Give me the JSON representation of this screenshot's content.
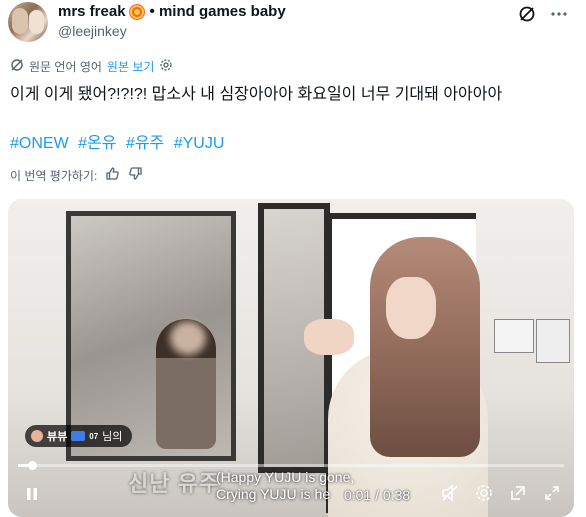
{
  "author": {
    "display_name": "mrs freak",
    "name_suffix": "• mind games baby",
    "handle": "@leejinkey"
  },
  "translation_bar": {
    "label": "원문 언어 영어",
    "link": "원본 보기"
  },
  "tweet": {
    "text": "이게 이게 됐어?!?!?! 맙소사 내 심장아아아 화요일이 너무 기대돼 아아아아",
    "hashtags": [
      "#ONEW",
      "#온유",
      "#유주",
      "#YUJU"
    ]
  },
  "rate_translation": {
    "label": "이 번역 평가하기:"
  },
  "video": {
    "channel_name": "뷰뷰",
    "channel_badge_sup": "07",
    "channel_suffix": "님의",
    "burned_caption_ko": "신난 유주",
    "subtitle_line1": "(Happy YUJU is gone,",
    "subtitle_line2": "Crying YUJU is he",
    "time_current": "0:01",
    "time_separator": "/",
    "time_total": "0:38",
    "progress_fraction": 0.026
  },
  "colors": {
    "accent": "#1d9bf0",
    "text_primary": "#0f1419",
    "text_secondary": "#536471"
  },
  "icons": {
    "top": [
      "grok-icon",
      "more-icon"
    ],
    "translate": "translate-icon",
    "settings": "settings-icon",
    "thumbs": [
      "thumbs-up-icon",
      "thumbs-down-icon"
    ],
    "player": [
      "pause-icon",
      "muted-icon",
      "gear-icon",
      "pop-out-icon",
      "fullscreen-icon"
    ]
  }
}
